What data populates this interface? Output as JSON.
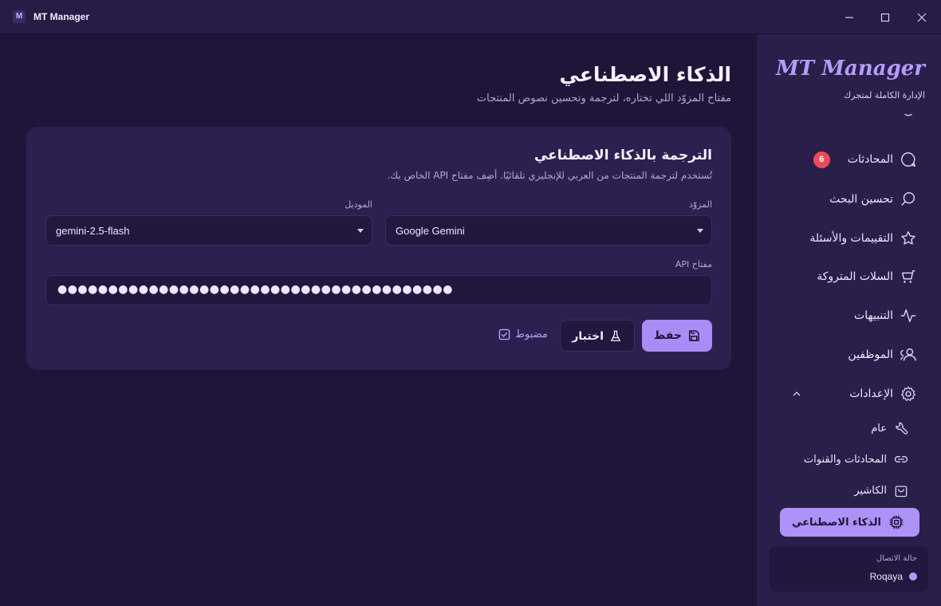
{
  "window": {
    "app_icon_letter": "M",
    "title": "MT Manager"
  },
  "header": {
    "title": "الذكاء الاصطناعي",
    "subtitle": "مفتاح المزوّد اللي تختاره، لترجمة وتحسين نصوص المنتجات"
  },
  "card": {
    "title": "الترجمة بالذكاء الاصطناعي",
    "description": "تُستخدم لترجمة المنتجات من العربي للإنجليزي تلقائيًا. أضِف مفتاح API الخاص بك.",
    "provider": {
      "label": "المزوّد",
      "value": "Google Gemini"
    },
    "model": {
      "label": "الموديل",
      "value": "gemini-2.5-flash"
    },
    "api_key": {
      "label": "مفتاح API",
      "value": "●●●●●●●●●●●●●●●●●●●●●●●●●●●●●●●●●●●●●●●"
    },
    "save_label": "حفظ",
    "test_label": "اختبار",
    "status_label": "مضبوط"
  },
  "sidebar": {
    "brand": "MT Manager",
    "brand_subtitle": "الإدارة الكاملة لمتجرك",
    "nav": [
      {
        "label": "المحادثات",
        "badge": "6",
        "icon": "chat-icon"
      },
      {
        "label": "تحسين البحث",
        "icon": "search-icon"
      },
      {
        "label": "التقييمات والأسئلة",
        "icon": "star-icon"
      },
      {
        "label": "السلات المتروكة",
        "icon": "cart-icon"
      },
      {
        "label": "التنبيهات",
        "icon": "activity-icon"
      },
      {
        "label": "الموظفين",
        "icon": "users-icon"
      },
      {
        "label": "الإعدادات",
        "icon": "gear-icon"
      }
    ],
    "settings_sub": [
      {
        "label": "عام",
        "icon": "wrench-icon"
      },
      {
        "label": "المحادثات والقنوات",
        "icon": "link-icon"
      },
      {
        "label": "الكاشير",
        "icon": "shopping-bag-icon"
      },
      {
        "label": "الذكاء الاصطناعي",
        "icon": "chip-icon",
        "active": true
      }
    ],
    "connection": {
      "label": "حالة الاتصال",
      "user": "Roqaya"
    }
  },
  "colors": {
    "background": "#1f1538",
    "sidebar": "#2a1f4a",
    "card": "#2c2050",
    "accent": "#a98cf5",
    "badge": "#ef4a5a"
  }
}
